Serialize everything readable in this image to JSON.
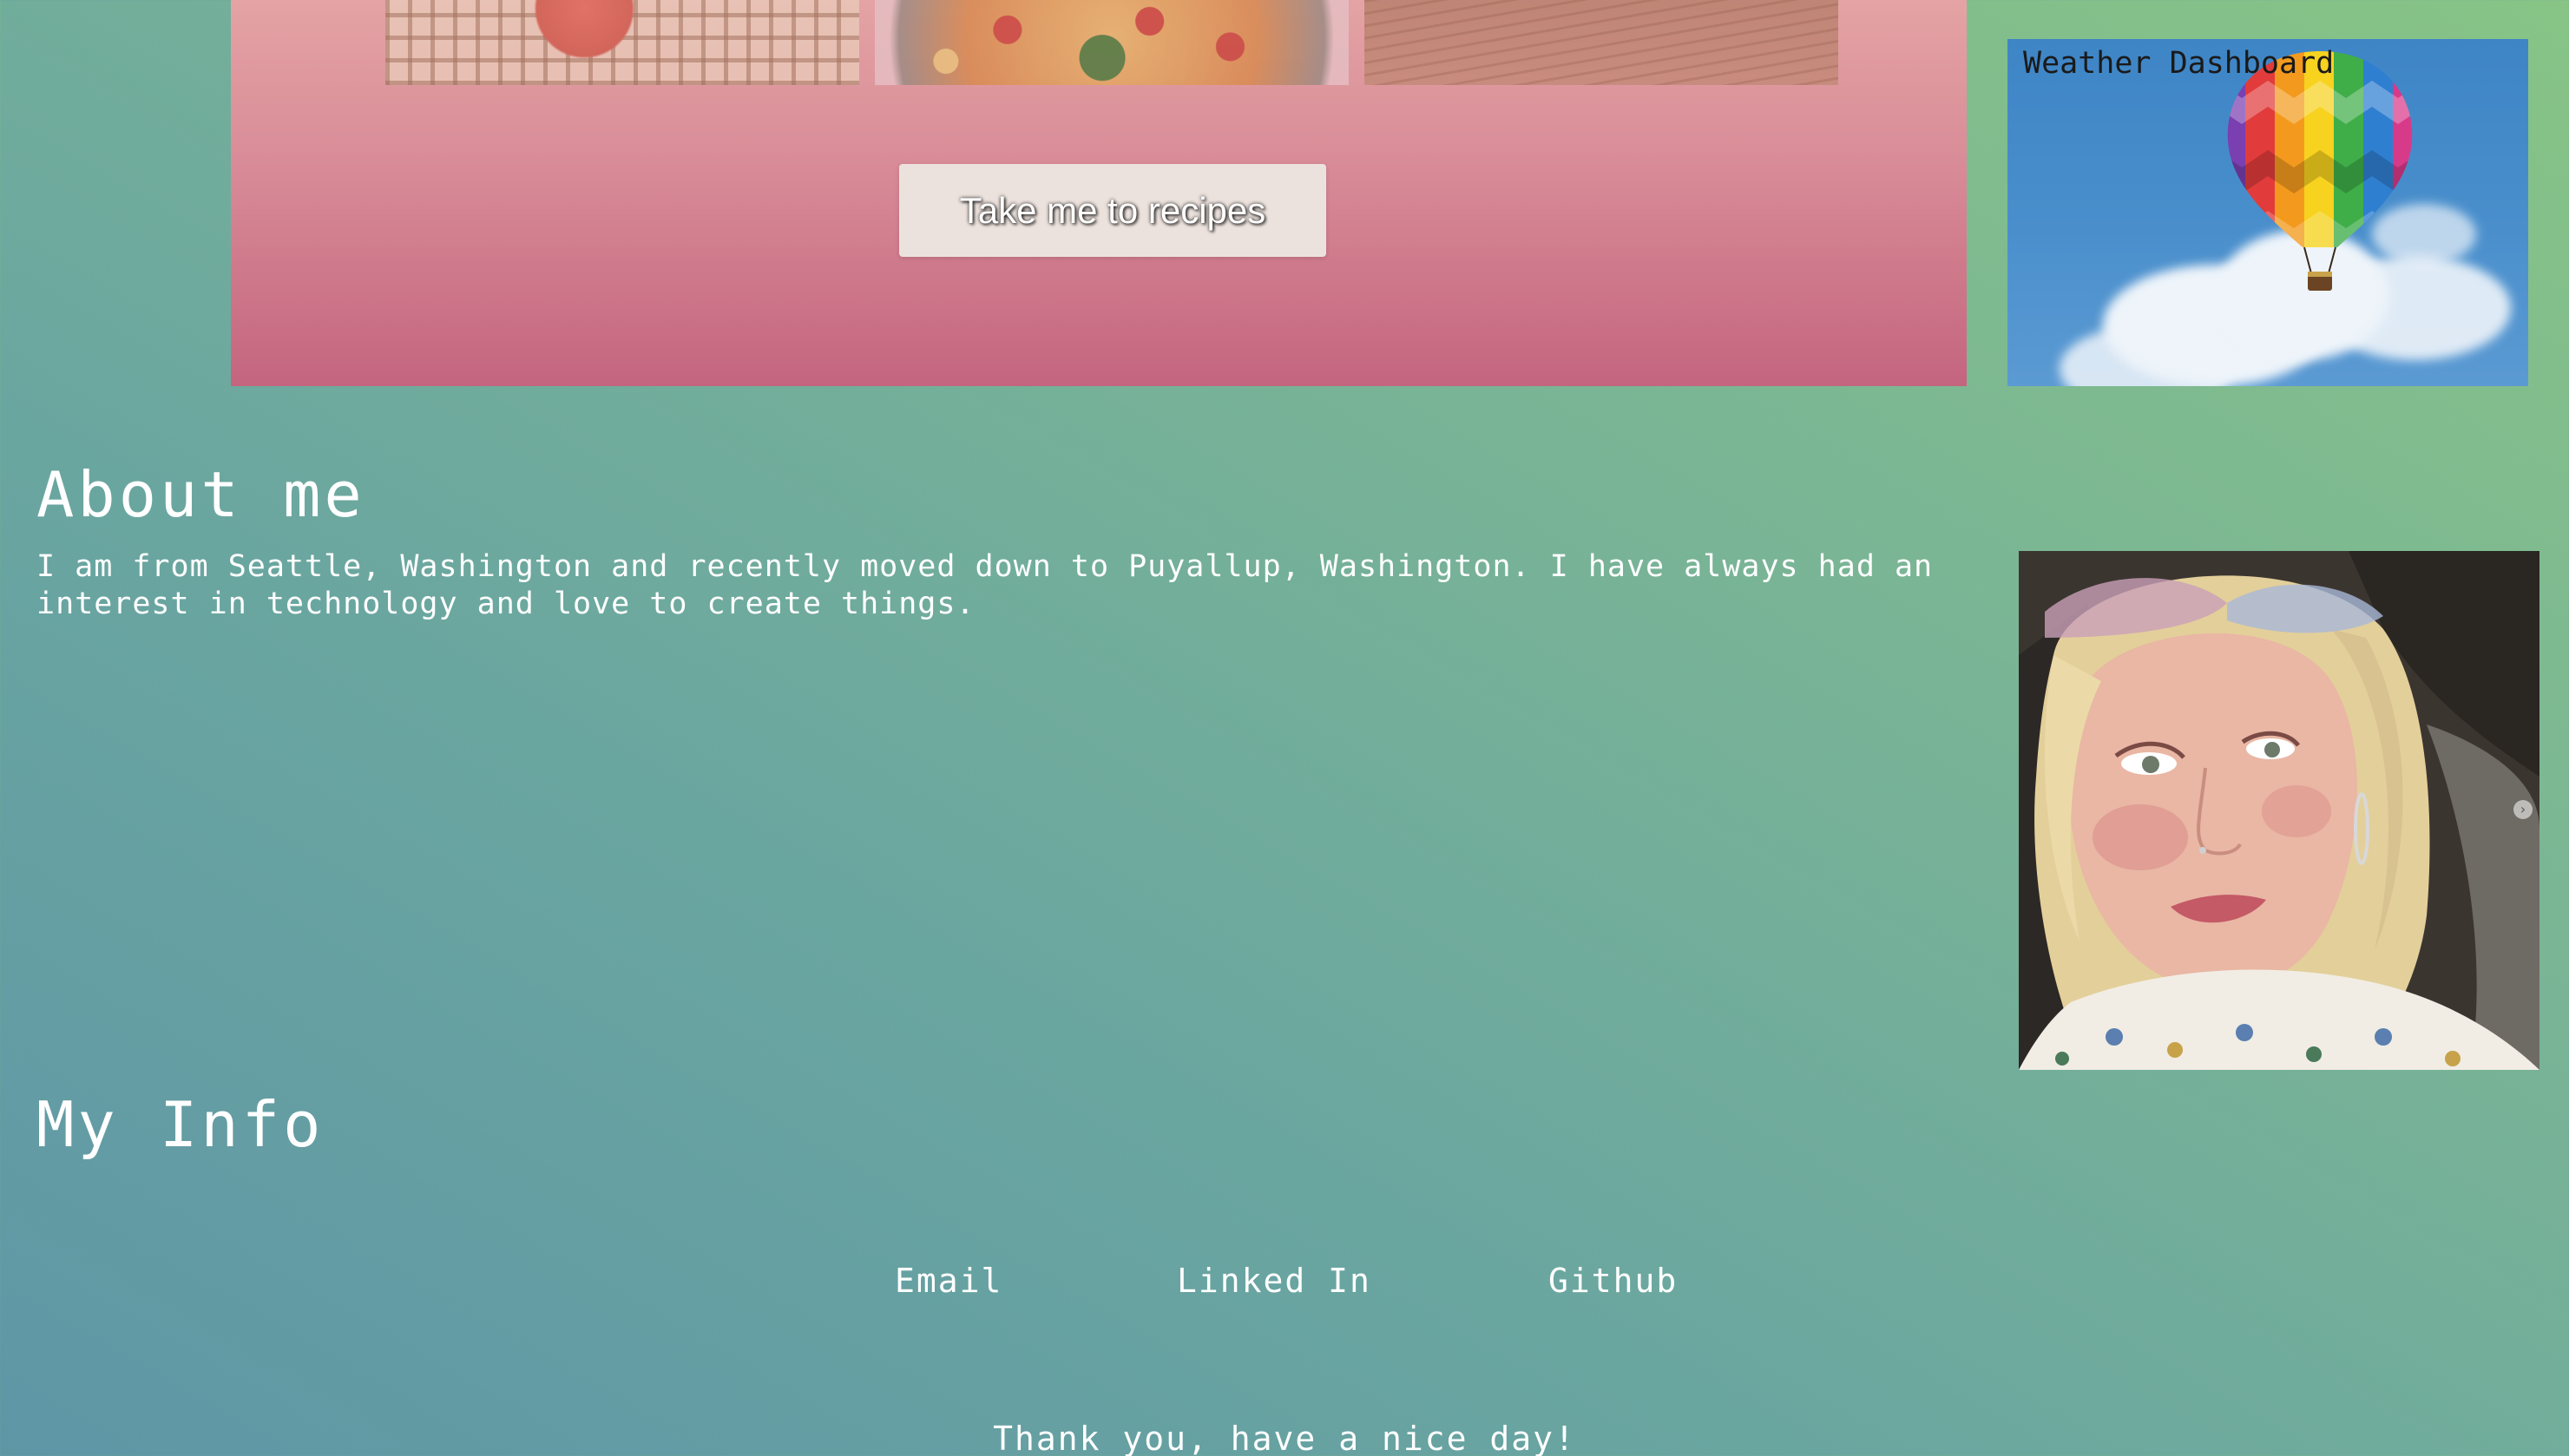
{
  "recipes": {
    "thumbnails": [
      "tomato-photo",
      "pizza-photo",
      "wood-table-photo"
    ],
    "button_label": "Take me to recipes"
  },
  "weather": {
    "title": "Weather Dashboard",
    "image": "hot-air-balloon-photo"
  },
  "about": {
    "heading": "About me",
    "text": "I am from Seattle, Washington and recently moved down to Puyallup, Washington. I have always had an interest in technology and love to create things.",
    "photo": "portrait-photo"
  },
  "info": {
    "heading": "My Info",
    "links": {
      "email": "Email",
      "linkedin": "Linked In",
      "github": "Github"
    }
  },
  "footer": {
    "text": "Thank you, have a nice day!"
  },
  "colors": {
    "recipes_card_top": "#e4a3a4",
    "recipes_card_bottom": "#c4657f",
    "page_bg_left": "#5f96a6",
    "page_bg_right": "#87c486"
  }
}
